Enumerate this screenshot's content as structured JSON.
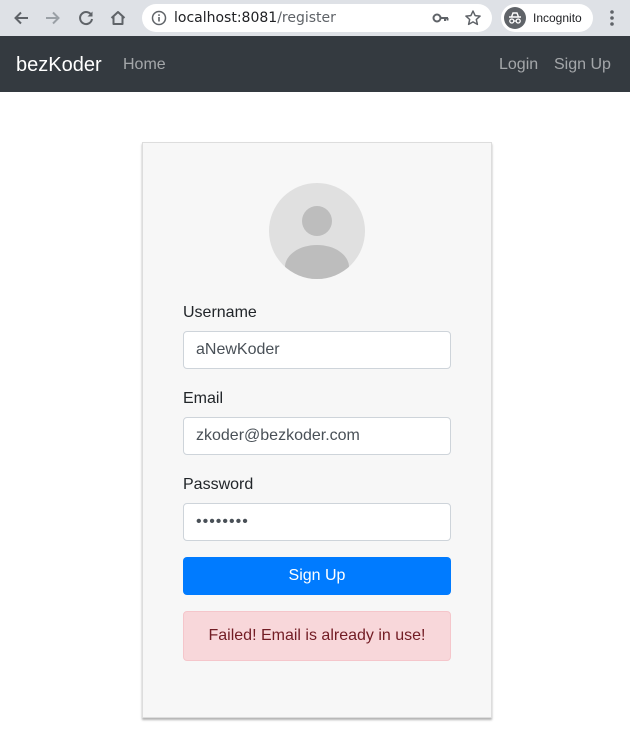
{
  "browser": {
    "url_host": "localhost:8081",
    "url_path": "/register",
    "incognito_label": "Incognito",
    "icons": [
      "back-arrow-icon",
      "forward-arrow-icon",
      "reload-icon",
      "home-icon",
      "info-icon",
      "key-icon",
      "star-icon",
      "incognito-icon",
      "kebab-menu-icon"
    ]
  },
  "navbar": {
    "brand": "bezKoder",
    "home": "Home",
    "login": "Login",
    "signup": "Sign Up",
    "background": "#343a40"
  },
  "form": {
    "avatar_icon": "user-avatar-icon",
    "username_label": "Username",
    "username_value": "aNewKoder",
    "email_label": "Email",
    "email_value": "zkoder@bezkoder.com",
    "password_label": "Password",
    "password_value": "••••••••",
    "submit_label": "Sign Up",
    "submit_color": "#007bff",
    "error_message": "Failed! Email is already in use!",
    "error_bg": "#f8d7da"
  }
}
